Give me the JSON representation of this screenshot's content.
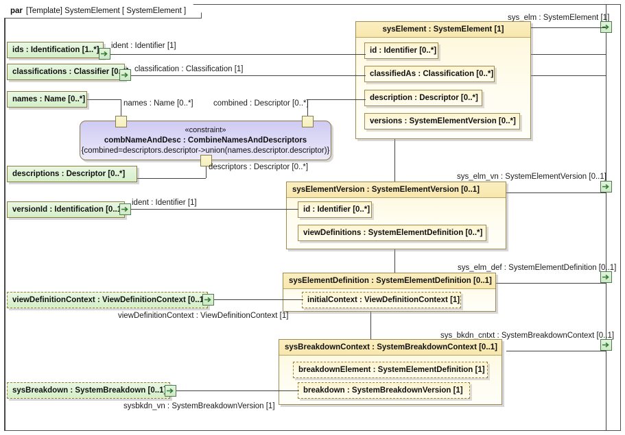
{
  "frame": {
    "keyword": "par",
    "title": "[Template] SystemElement [ SystemElement ]"
  },
  "colors": {
    "green_fill": "#d4efc8",
    "yellow_fill": "#fdf6d8",
    "yellow_header": "#f8e7ad",
    "constraint_fill": "#dcd8f6",
    "border": "#9c8a52",
    "line": "#404040",
    "port_green_border": "#4a7a4a"
  },
  "green_boxes": [
    {
      "id": "ids",
      "label": "ids : Identification [1..*]",
      "dashed": false
    },
    {
      "id": "classifications",
      "label": "classifications : Classifier [0..*]",
      "dashed": false
    },
    {
      "id": "names",
      "label": "names : Name [0..*]",
      "dashed": false
    },
    {
      "id": "descriptions",
      "label": "descriptions : Descriptor [0..*]",
      "dashed": false
    },
    {
      "id": "versionId",
      "label": "versionId : Identification [0..1]",
      "dashed": false
    },
    {
      "id": "viewDefinitionContext",
      "label": "viewDefinitionContext : ViewDefinitionContext [0..1]",
      "dashed": true
    },
    {
      "id": "sysBreakdown",
      "label": "sysBreakdown : SystemBreakdown [0..1]",
      "dashed": true
    }
  ],
  "constraint": {
    "stereotype": "«constraint»",
    "name": "combNameAndDesc : CombineNamesAndDescriptors",
    "expression": "{combined=descriptors.descriptor->union(names.descriptor.descriptor)}"
  },
  "blocks": [
    {
      "id": "sysElement",
      "title": "sysElement : SystemElement [1]",
      "title_align": "center",
      "properties": [
        {
          "label": "id : Identifier [0..*]",
          "dashed": false
        },
        {
          "label": "classifiedAs : Classification [0..*]",
          "dashed": false
        },
        {
          "label": "description : Descriptor [0..*]",
          "dashed": false
        },
        {
          "label": "versions : SystemElementVersion [0..*]",
          "dashed": false
        }
      ]
    },
    {
      "id": "sysElementVersion",
      "title": "sysElementVersion : SystemElementVersion [0..1]",
      "title_align": "left",
      "properties": [
        {
          "label": "id : Identifier [0..*]",
          "dashed": false
        },
        {
          "label": "viewDefinitions : SystemElementDefinition [0..*]",
          "dashed": false
        }
      ]
    },
    {
      "id": "sysElementDefinition",
      "title": "sysElementDefinition : SystemElementDefinition [0..1]",
      "title_align": "left",
      "properties": [
        {
          "label": "initialContext : ViewDefinitionContext [1]",
          "dashed": true
        }
      ]
    },
    {
      "id": "sysBreakdownContext",
      "title": "sysBreakdownContext : SystemBreakdownContext [0..1]",
      "title_align": "left",
      "properties": [
        {
          "label": "breakdownElement : SystemElementDefinition [1]",
          "dashed": true
        },
        {
          "label": "breakdown : SystemBreakdownVersion [1]",
          "dashed": true
        }
      ]
    }
  ],
  "connector_labels": [
    {
      "id": "ident-1",
      "text": "ident : Identifier [1]"
    },
    {
      "id": "classification",
      "text": "classification : Classification [1]"
    },
    {
      "id": "names-link",
      "text": "names : Name [0..*]"
    },
    {
      "id": "combined",
      "text": "combined : Descriptor [0..*]"
    },
    {
      "id": "descriptors",
      "text": "descriptors : Descriptor [0..*]"
    },
    {
      "id": "ident-2",
      "text": "ident : Identifier [1]"
    },
    {
      "id": "viewDefinitionContext",
      "text": "viewDefinitionContext : ViewDefinitionContext [1]"
    },
    {
      "id": "sysbkdn_vn",
      "text": "sysbkdn_vn : SystemBreakdownVersion [1]"
    }
  ],
  "boundary_ports": [
    {
      "id": "sys_elm",
      "text": "sys_elm : SystemElement [1]"
    },
    {
      "id": "sys_elm_vn",
      "text": "sys_elm_vn : SystemElementVersion [0..1]"
    },
    {
      "id": "sys_elm_def",
      "text": "sys_elm_def : SystemElementDefinition [0..1]"
    },
    {
      "id": "sys_bkdn_cntxt",
      "text": "sys_bkdn_cntxt : SystemBreakdownContext [0..1]"
    }
  ]
}
